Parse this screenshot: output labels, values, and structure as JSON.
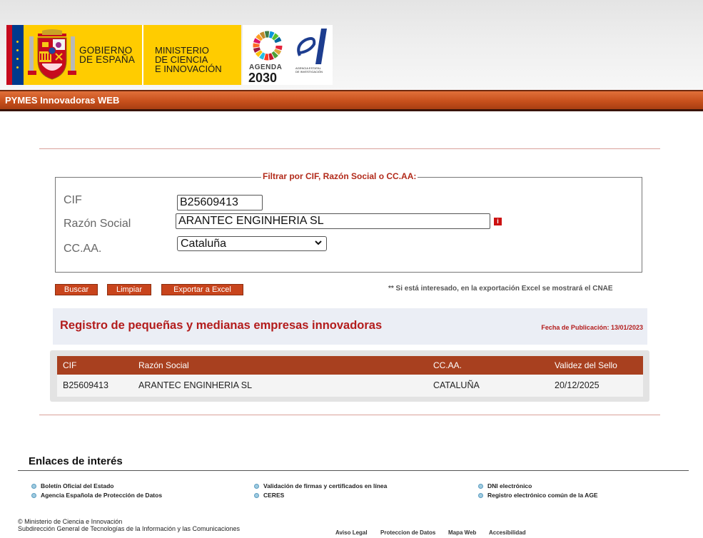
{
  "header": {
    "gobierno_line1": "GOBIERNO",
    "gobierno_line2": "DE ESPAÑA",
    "ministerio_line1": "MINISTERIO",
    "ministerio_line2": "DE CIENCIA",
    "ministerio_line3": "E INNOVACIÓN",
    "agenda_line1": "AGENDA",
    "agenda_line2": "2030",
    "aei_text": "AGENCIA ESTATAL DE INVESTIGACIÓN"
  },
  "titlebar": {
    "title": "PYMES Innovadoras WEB"
  },
  "filter": {
    "legend": "Filtrar por CIF, Razón Social o CC.AA:",
    "cif_label": "CIF",
    "cif_value": "B25609413",
    "razon_label": "Razón Social",
    "razon_value": "ARANTEC ENGINHERIA SL",
    "ccaa_label": "CC.AA.",
    "ccaa_value": "Cataluña"
  },
  "buttons": {
    "buscar": "Buscar",
    "limpiar": "Limpiar",
    "exportar": "Exportar a Excel"
  },
  "note": "** Si está interesado, en la exportación Excel se mostrará el CNAE",
  "registro": {
    "title": "Registro de pequeñas y medianas empresas innovadoras",
    "fecha": "Fecha de Publicación: 13/01/2023"
  },
  "table": {
    "headers": [
      "CIF",
      "Razón Social",
      "CC.AA.",
      "Validez del Sello"
    ],
    "rows": [
      [
        "B25609413",
        "ARANTEC ENGINHERIA SL",
        "CATALUÑA",
        "20/12/2025"
      ]
    ]
  },
  "links": {
    "title": "Enlaces de interés",
    "items": [
      "Boletín Oficial del Estado",
      "Agencia Española de Protección de Datos",
      "Validación de firmas y certificados en línea",
      "CERES",
      "DNI electrónico",
      "Registro electrónico común de la AGE"
    ]
  },
  "footer": {
    "copy_line1": "© Ministerio de Ciencia e Innovación",
    "copy_line2": "Subdirección General de Tecnologías de la Información y las Comunicaciones",
    "aviso": "Aviso Legal",
    "proteccion": "Proteccion de Datos",
    "mapa": "Mapa Web",
    "accesibilidad": "Accesibilidad"
  },
  "colors": {
    "accent": "#c8441c",
    "title_red": "#b31c1c",
    "header_yellow": "#ffcc00"
  }
}
